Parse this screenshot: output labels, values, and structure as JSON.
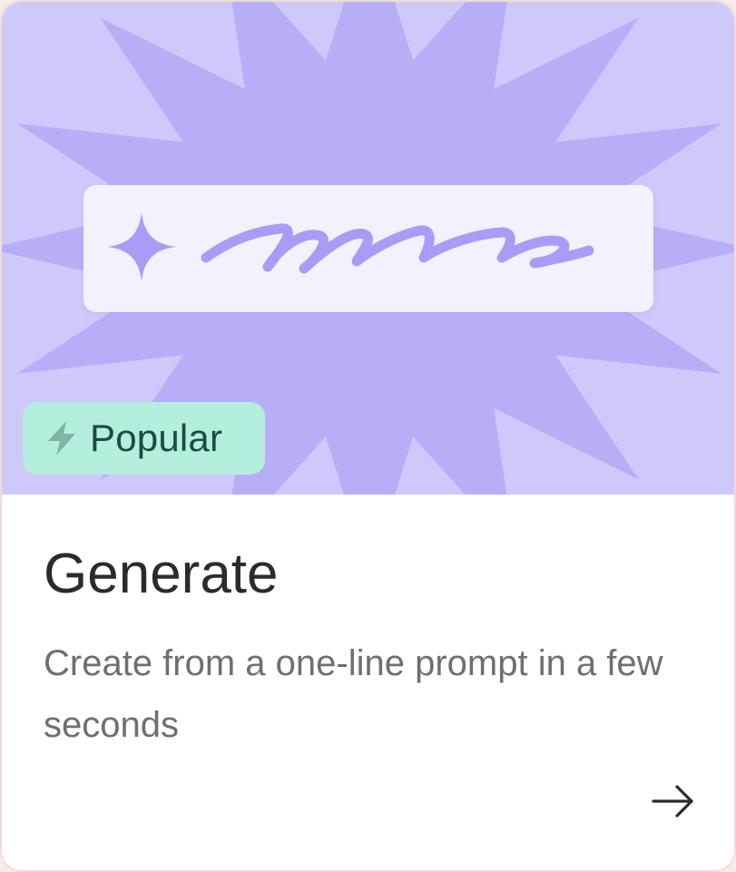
{
  "card": {
    "badge": {
      "label": "Popular",
      "icon": "lightning-bolt-icon"
    },
    "title": "Generate",
    "description": "Create from a one-line prompt in a few seconds",
    "action_icon": "arrow-right-icon"
  },
  "colors": {
    "hero_background": "#cfc8fb",
    "burst": "#b8aef8",
    "prompt_box": "#f3f1fd",
    "accent_purple": "#a99cf6",
    "badge_background": "#b4eedd",
    "badge_text": "#1c4a44",
    "title_text": "#2b2b2b",
    "description_text": "#6f6f6f"
  }
}
